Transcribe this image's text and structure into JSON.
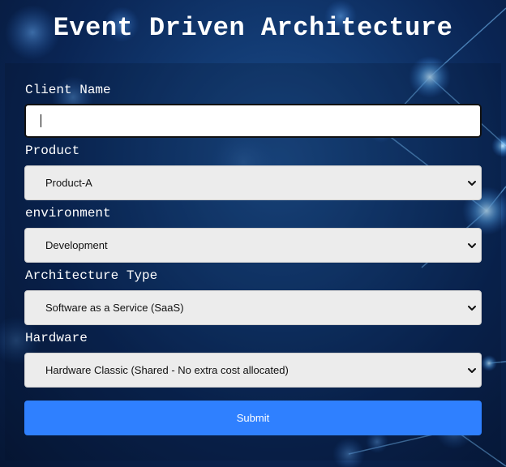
{
  "page": {
    "title": "Event Driven Architecture"
  },
  "form": {
    "client_name": {
      "label": "Client Name",
      "value": "",
      "placeholder": ""
    },
    "product": {
      "label": "Product",
      "selected": "Product-A"
    },
    "environment": {
      "label": "environment",
      "selected": "Development"
    },
    "architecture_type": {
      "label": "Architecture Type",
      "selected": "Software as a Service (SaaS)"
    },
    "hardware": {
      "label": "Hardware",
      "selected": "Hardware Classic (Shared - No extra cost allocated)"
    },
    "submit_label": "Submit"
  },
  "icons": {
    "select_arrow": "chevron-down-icon"
  },
  "colors": {
    "background": "#0a2554",
    "accent_button": "#2f80ff",
    "select_background": "#ececec",
    "text_light": "#ffffff"
  }
}
